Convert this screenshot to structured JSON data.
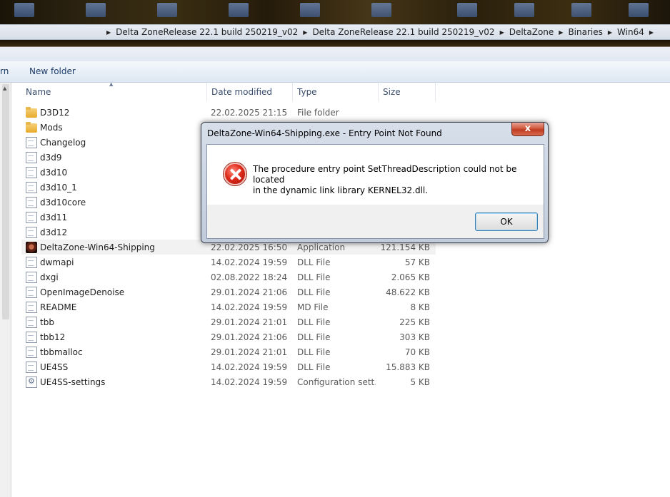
{
  "address_bar": {
    "crumbs": [
      "Delta ZoneRelease 22.1 build 250219_v02",
      "Delta ZoneRelease 22.1 build 250219_v02",
      "DeltaZone",
      "Binaries",
      "Win64"
    ]
  },
  "command_bar": {
    "partial_item": "rn",
    "new_folder": "New folder"
  },
  "columns": {
    "name": "Name",
    "date_modified": "Date modified",
    "type": "Type",
    "size": "Size"
  },
  "files": [
    {
      "name": "D3D12",
      "date": "22.02.2025 21:15",
      "type": "File folder",
      "size": "",
      "icon": "folder-icon"
    },
    {
      "name": "Mods",
      "date": "",
      "type": "",
      "size": "",
      "icon": "folder-icon"
    },
    {
      "name": "Changelog",
      "date": "",
      "type": "",
      "size": "",
      "icon": "document-icon"
    },
    {
      "name": "d3d9",
      "date": "",
      "type": "",
      "size": "",
      "icon": "document-icon"
    },
    {
      "name": "d3d10",
      "date": "",
      "type": "",
      "size": "",
      "icon": "document-icon"
    },
    {
      "name": "d3d10_1",
      "date": "",
      "type": "",
      "size": "",
      "icon": "document-icon"
    },
    {
      "name": "d3d10core",
      "date": "",
      "type": "",
      "size": "",
      "icon": "document-icon"
    },
    {
      "name": "d3d11",
      "date": "",
      "type": "",
      "size": "",
      "icon": "document-icon"
    },
    {
      "name": "d3d12",
      "date": "",
      "type": "",
      "size": "",
      "icon": "document-icon"
    },
    {
      "name": "DeltaZone-Win64-Shipping",
      "date": "22.02.2025 16:50",
      "type": "Application",
      "size": "121.154 KB",
      "icon": "application-icon"
    },
    {
      "name": "dwmapi",
      "date": "14.02.2024 19:59",
      "type": "DLL File",
      "size": "57 KB",
      "icon": "document-icon"
    },
    {
      "name": "dxgi",
      "date": "02.08.2022 18:24",
      "type": "DLL File",
      "size": "2.065 KB",
      "icon": "document-icon"
    },
    {
      "name": "OpenImageDenoise",
      "date": "29.01.2024 21:06",
      "type": "DLL File",
      "size": "48.622 KB",
      "icon": "document-icon"
    },
    {
      "name": "README",
      "date": "14.02.2024 19:59",
      "type": "MD File",
      "size": "8 KB",
      "icon": "document-icon"
    },
    {
      "name": "tbb",
      "date": "29.01.2024 21:01",
      "type": "DLL File",
      "size": "225 KB",
      "icon": "document-icon"
    },
    {
      "name": "tbb12",
      "date": "29.01.2024 21:06",
      "type": "DLL File",
      "size": "303 KB",
      "icon": "document-icon"
    },
    {
      "name": "tbbmalloc",
      "date": "29.01.2024 21:01",
      "type": "DLL File",
      "size": "70 KB",
      "icon": "document-icon"
    },
    {
      "name": "UE4SS",
      "date": "14.02.2024 19:59",
      "type": "DLL File",
      "size": "15.883 KB",
      "icon": "document-icon"
    },
    {
      "name": "UE4SS-settings",
      "date": "14.02.2024 19:59",
      "type": "Configuration sett...",
      "size": "5 KB",
      "icon": "settings-file-icon"
    }
  ],
  "dialog": {
    "title": "DeltaZone-Win64-Shipping.exe - Entry Point Not Found",
    "close_label": "x",
    "message_line1": "The procedure entry point SetThreadDescription could not be located",
    "message_line2": "in the dynamic link library KERNEL32.dll.",
    "ok_label": "OK",
    "icon": "error-icon"
  }
}
